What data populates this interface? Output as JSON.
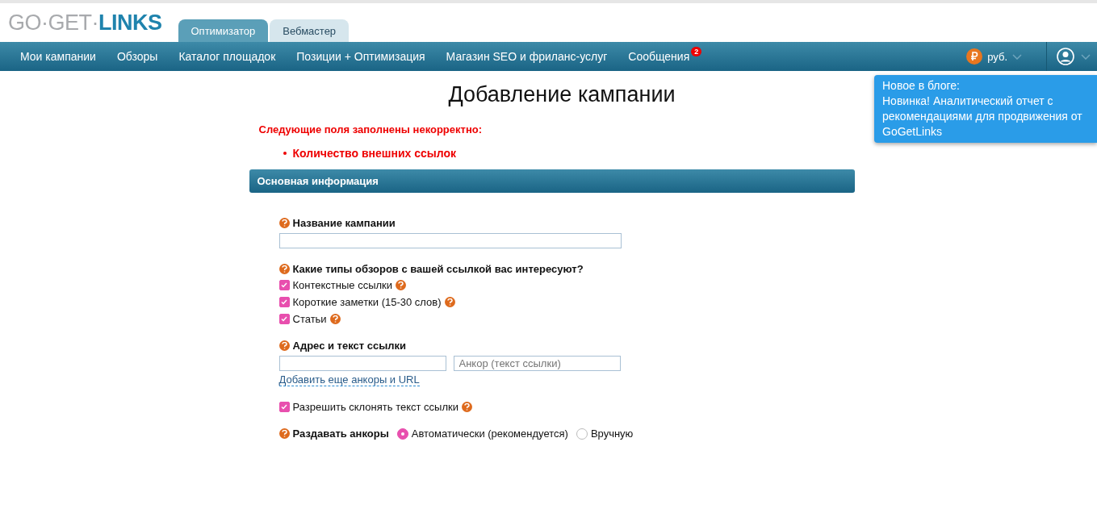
{
  "logo": {
    "light": "GO·GET·",
    "bold": "LINKS"
  },
  "role_tabs": [
    {
      "label": "Оптимизатор",
      "selected": true
    },
    {
      "label": "Вебмастер",
      "selected": false
    }
  ],
  "nav": {
    "items": [
      {
        "label": "Мои кампании"
      },
      {
        "label": "Обзоры"
      },
      {
        "label": "Каталог площадок"
      },
      {
        "label": "Позиции + Оптимизация"
      },
      {
        "label": "Магазин SEO и фриланс-услуг"
      },
      {
        "label": "Сообщения",
        "badge": "2"
      }
    ],
    "currency": "руб."
  },
  "blog_popup": {
    "heading": "Новое в блоге:",
    "text": "Новинка! Аналитический отчет с рекомендациями для продвижения от GoGetLinks"
  },
  "page_title": "Добавление кампании",
  "error": {
    "heading": "Следующие поля заполнены некорректно:",
    "items": [
      "Количество внешних ссылок"
    ]
  },
  "section_title": "Основная информация",
  "form": {
    "name_label": "Название кампании",
    "types_label": "Какие типы обзоров с вашей ссылкой вас интересуют?",
    "types": [
      {
        "label": "Контекстные ссылки",
        "checked": true
      },
      {
        "label": "Короткие заметки (15-30 слов)",
        "checked": true
      },
      {
        "label": "Статьи",
        "checked": true
      }
    ],
    "link_label": "Адрес и текст ссылки",
    "anchor_placeholder": "Анкор (текст ссылки)",
    "add_link": "Добавить еще анкоры и URL",
    "decline": {
      "label": "Разрешить склонять текст ссылки",
      "checked": true
    },
    "distribute_label": "Раздавать анкоры",
    "distribute_options": [
      {
        "label": "Автоматически (рекомендуется)",
        "selected": true
      },
      {
        "label": "Вручную",
        "selected": false
      }
    ]
  }
}
